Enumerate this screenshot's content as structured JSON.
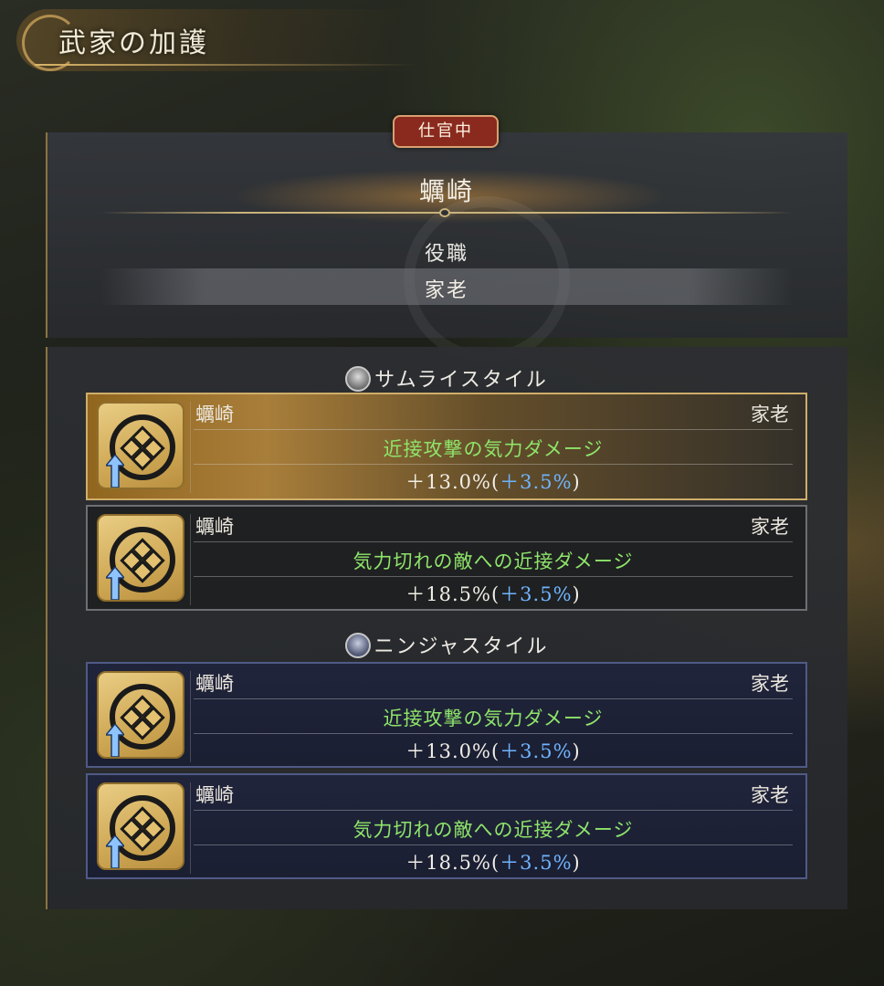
{
  "header": {
    "title": "武家の加護"
  },
  "status_badge": "仕官中",
  "clan": {
    "name": "蠣崎",
    "role_label": "役職",
    "role_value": "家老"
  },
  "sections": [
    {
      "title": "サムライスタイル",
      "icon": "samurai-helmet-icon",
      "cards": [
        {
          "clan": "蠣崎",
          "rank": "家老",
          "effect": "近接攻撃の気力ダメージ",
          "value": "＋13.0%",
          "bonus_open": "(",
          "bonus": "＋3.5%",
          "bonus_close": ")"
        },
        {
          "clan": "蠣崎",
          "rank": "家老",
          "effect": "気力切れの敵への近接ダメージ",
          "value": "＋18.5%",
          "bonus_open": "(",
          "bonus": "＋3.5%",
          "bonus_close": ")"
        }
      ]
    },
    {
      "title": "ニンジャスタイル",
      "icon": "ninja-mask-icon",
      "cards": [
        {
          "clan": "蠣崎",
          "rank": "家老",
          "effect": "近接攻撃の気力ダメージ",
          "value": "＋13.0%",
          "bonus_open": "(",
          "bonus": "＋3.5%",
          "bonus_close": ")"
        },
        {
          "clan": "蠣崎",
          "rank": "家老",
          "effect": "気力切れの敵への近接ダメージ",
          "value": "＋18.5%",
          "bonus_open": "(",
          "bonus": "＋3.5%",
          "bonus_close": ")"
        }
      ]
    }
  ],
  "colors": {
    "effect_text": "#8ee46a",
    "bonus_text": "#6fb4ff",
    "badge_bg": "#8a2a1e",
    "gold_accent": "#c9a25a"
  }
}
